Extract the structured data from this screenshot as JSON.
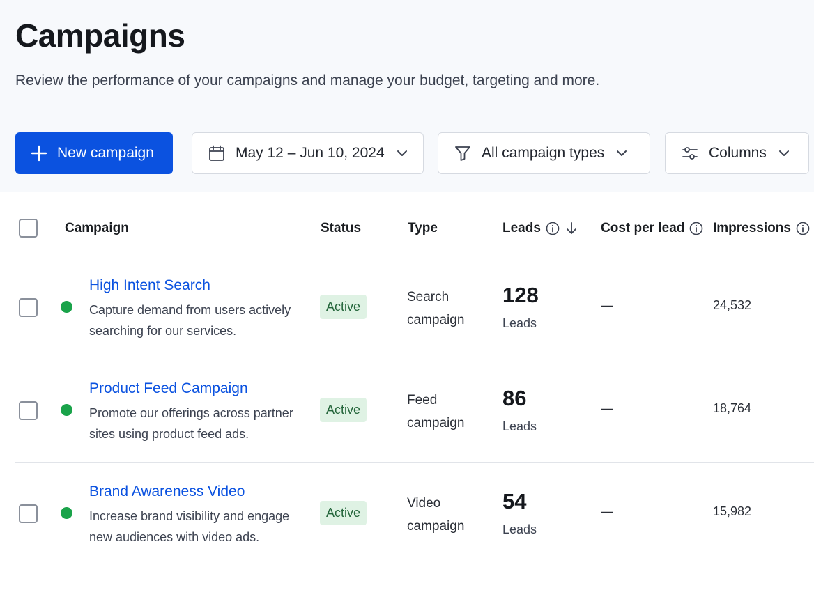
{
  "page": {
    "title": "Campaigns",
    "subtitle": "Review the performance of your campaigns and manage your budget, targeting and more."
  },
  "toolbar": {
    "new_campaign_label": "New campaign",
    "date_range": "May 12 – Jun 10, 2024",
    "type_filter": "All campaign types",
    "columns_label": "Columns"
  },
  "table": {
    "headers": {
      "campaign": "Campaign",
      "status": "Status",
      "type": "Type",
      "leads": "Leads",
      "cost_per_lead": "Cost per lead",
      "impressions": "Impressions"
    },
    "rows": [
      {
        "name": "High Intent Search",
        "description": "Capture demand from users actively searching for our services.",
        "status": "Active",
        "type": "Search campaign",
        "leads": "128",
        "leads_label": "Leads",
        "cost_per_lead": "—",
        "impressions": "24,532"
      },
      {
        "name": "Product Feed Campaign",
        "description": "Promote our offerings across partner sites using product feed ads.",
        "status": "Active",
        "type": "Feed campaign",
        "leads": "86",
        "leads_label": "Leads",
        "cost_per_lead": "—",
        "impressions": "18,764"
      },
      {
        "name": "Brand Awareness Video",
        "description": "Increase brand visibility and engage new audiences with video ads.",
        "status": "Active",
        "type": "Video campaign",
        "leads": "54",
        "leads_label": "Leads",
        "cost_per_lead": "—",
        "impressions": "15,982"
      }
    ]
  },
  "colors": {
    "primary": "#0b52e0",
    "active_dot": "#1aa34a",
    "badge_bg": "#dff2e4",
    "badge_text": "#23653a"
  },
  "icons": {
    "new_campaign": "plus-icon",
    "date": "calendar-icon",
    "types": "filter-icon",
    "columns": "sliders-icon",
    "dropdown": "chevron-down-icon",
    "info": "info-icon",
    "sort": "arrow-down-icon"
  }
}
